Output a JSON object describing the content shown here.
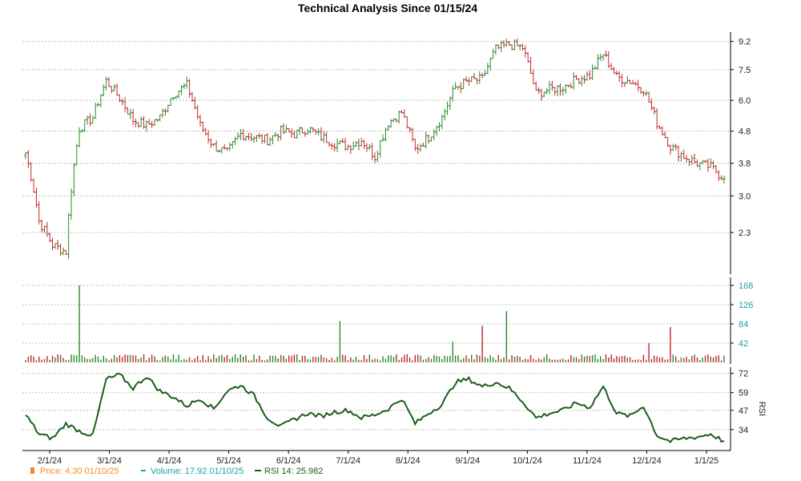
{
  "chart_data": {
    "type": "line",
    "title": "Technical Analysis Since 01/15/24",
    "colors": {
      "up": "#2a8a2a",
      "down": "#c0282d",
      "volume_up": "#2a8a2a",
      "volume_down": "#c0282d",
      "rsi": "#1b5e1b",
      "price_legend": "#f08c1e",
      "volume_legend": "#1aa3a3",
      "grid": "#c0c0c0"
    },
    "x_axis": {
      "tick_labels": [
        "2/1/24",
        "3/1/24",
        "4/1/24",
        "5/1/24",
        "6/1/24",
        "7/1/24",
        "8/1/24",
        "9/1/24",
        "10/1/24",
        "11/1/24",
        "12/1/24",
        "1/1/25"
      ]
    },
    "price_panel": {
      "scale": "log",
      "ylim": [
        1.75,
        9.4
      ],
      "tick_labels": [
        "9.2",
        "7.5",
        "6.0",
        "4.8",
        "3.8",
        "3.0",
        "2.3"
      ],
      "series": [
        {
          "kind": "ohlc",
          "x": [
            "1/15/24",
            "1/22/24",
            "1/29/24",
            "2/5/24",
            "2/12/24",
            "2/19/24",
            "2/26/24",
            "3/4/24",
            "3/11/24",
            "3/18/24",
            "3/25/24",
            "4/1/24",
            "4/8/24",
            "4/15/24",
            "4/22/24",
            "4/29/24",
            "5/6/24",
            "5/13/24",
            "5/20/24",
            "5/27/24",
            "6/3/24",
            "6/10/24",
            "6/17/24",
            "6/24/24",
            "7/1/24",
            "7/8/24",
            "7/15/24",
            "7/22/24",
            "7/29/24",
            "8/5/24",
            "8/12/24",
            "8/19/24",
            "8/26/24",
            "9/2/24",
            "9/9/24",
            "9/16/24",
            "9/23/24",
            "9/30/24",
            "10/7/24",
            "10/14/24",
            "10/21/24",
            "10/28/24",
            "11/4/24",
            "11/11/24",
            "11/18/24",
            "11/25/24",
            "12/2/24",
            "12/9/24",
            "12/16/24",
            "12/23/24",
            "12/30/24",
            "1/6/25",
            "1/10/25"
          ],
          "close": [
            4.1,
            2.5,
            2.1,
            2.0,
            4.9,
            5.3,
            6.9,
            6.1,
            5.2,
            5.0,
            5.3,
            6.3,
            6.7,
            5.0,
            4.3,
            4.1,
            4.7,
            4.6,
            4.5,
            4.8,
            4.7,
            4.9,
            4.6,
            4.4,
            4.3,
            4.5,
            4.0,
            5.1,
            5.5,
            4.2,
            4.6,
            5.3,
            6.6,
            6.9,
            7.0,
            8.7,
            9.0,
            8.8,
            6.3,
            6.5,
            6.6,
            7.0,
            7.2,
            8.4,
            7.1,
            6.9,
            6.5,
            5.1,
            4.3,
            4.0,
            3.8,
            3.7,
            3.4
          ]
        }
      ]
    },
    "volume_panel": {
      "ylim": [
        0,
        175
      ],
      "tick_labels": [
        "168",
        "126",
        "84",
        "42"
      ],
      "notable_spikes": [
        168,
        90,
        80,
        112,
        77,
        45,
        42
      ]
    },
    "rsi_panel": {
      "ylabel": "RSI",
      "ylim": [
        22,
        74
      ],
      "tick_labels": [
        "72",
        "59",
        "47",
        "34"
      ],
      "values": [
        44,
        31,
        28,
        38,
        33,
        30,
        68,
        71,
        62,
        70,
        60,
        56,
        50,
        55,
        48,
        60,
        64,
        57,
        42,
        36,
        41,
        45,
        43,
        46,
        47,
        42,
        44,
        48,
        55,
        38,
        45,
        51,
        66,
        68,
        63,
        66,
        62,
        53,
        42,
        45,
        47,
        52,
        49,
        63,
        45,
        43,
        50,
        30,
        26,
        28,
        29,
        31,
        26
      ]
    },
    "legend": [
      {
        "text": "Price: 4.30  01/10/25",
        "color": "#f08c1e"
      },
      {
        "text": "Volume: 17.92  01/10/25",
        "color": "#1aa3a3"
      },
      {
        "text": "RSI 14: 25.982",
        "color": "#1b5e1b"
      }
    ]
  }
}
